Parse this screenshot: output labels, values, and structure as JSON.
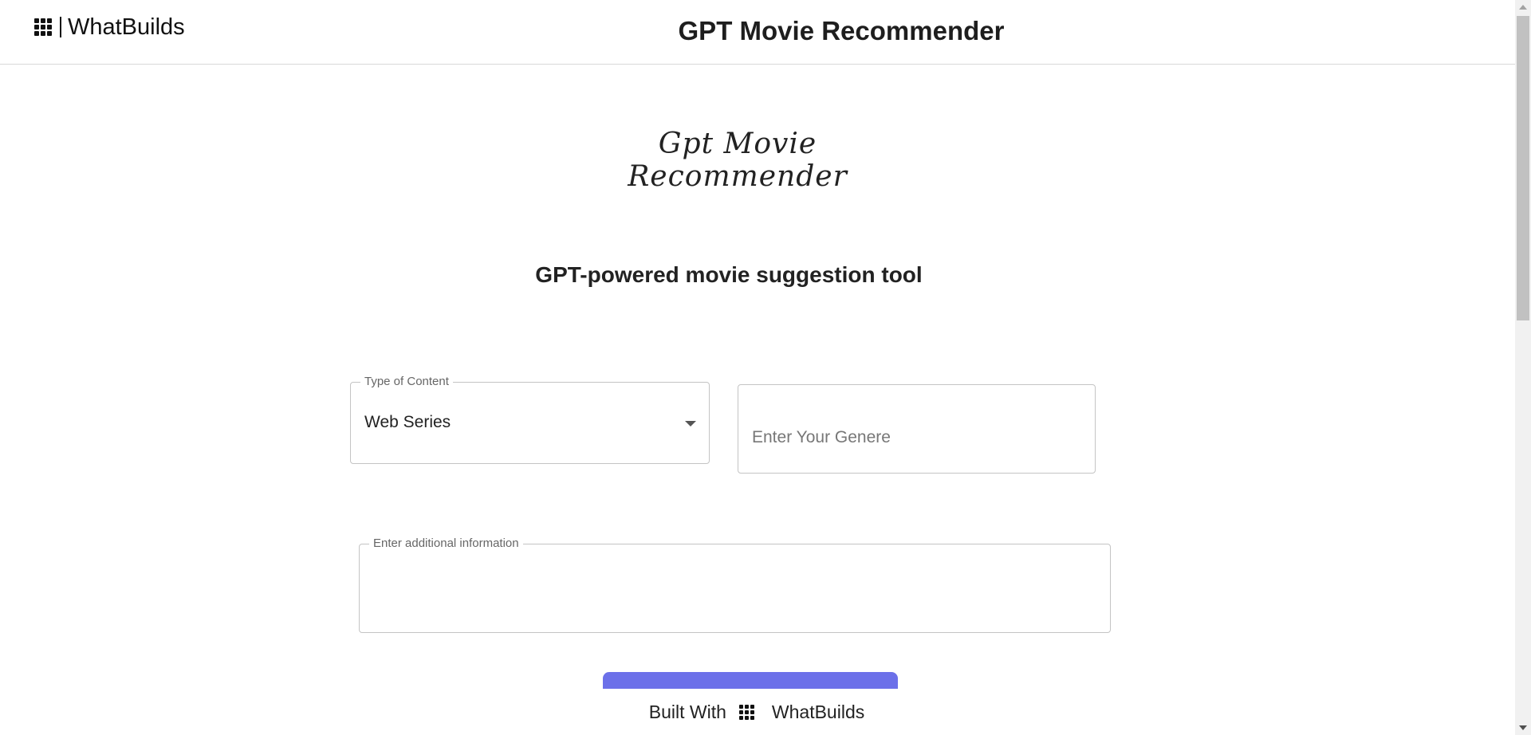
{
  "header": {
    "brand": "WhatBuilds",
    "title": "GPT Movie Recommender"
  },
  "hero": {
    "line1": "Gpt Movie",
    "line2": "Recommender"
  },
  "subtitle": "GPT-powered movie suggestion tool",
  "form": {
    "content_type": {
      "label": "Type of Content",
      "value": "Web Series"
    },
    "genre": {
      "placeholder": "Enter Your Genere",
      "value": ""
    },
    "additional_info": {
      "label": "Enter additional information",
      "value": ""
    },
    "submit_color": "#6c70e9"
  },
  "footer": {
    "prefix": "Built With",
    "brand": "WhatBuilds",
    "icon": "grid-logo-icon"
  }
}
